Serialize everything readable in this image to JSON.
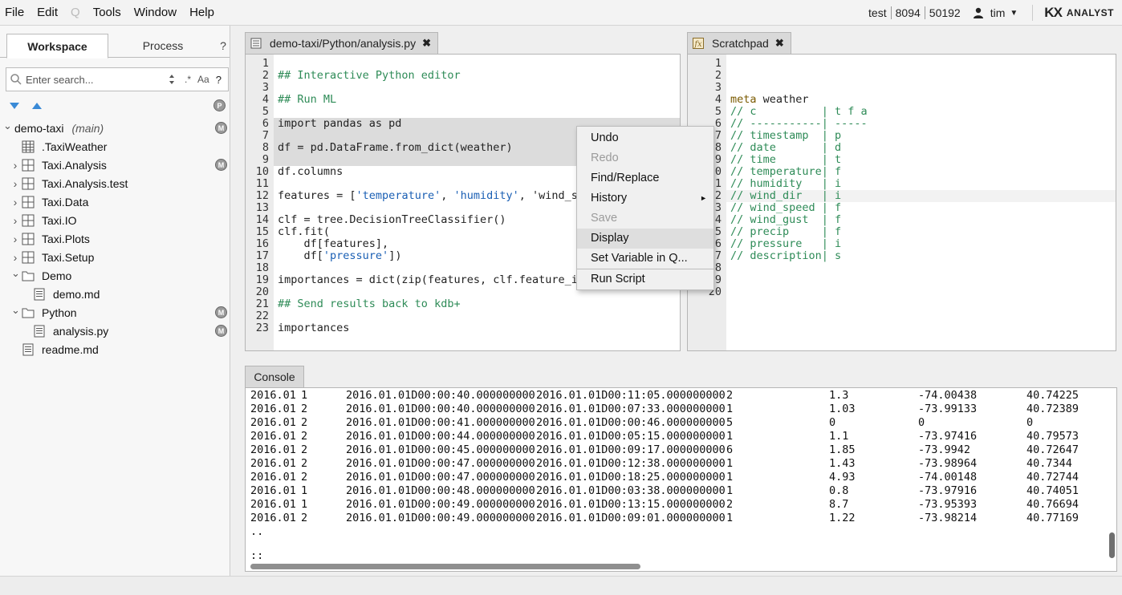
{
  "menu": {
    "items": [
      "File",
      "Edit",
      "Q",
      "Tools",
      "Window",
      "Help"
    ],
    "disabled_index": 2
  },
  "status": {
    "user_field": "test",
    "port": "8094",
    "pid": "50192",
    "username": "tim",
    "brand_kx": "KX",
    "brand_name": "ANALYST"
  },
  "sidebar": {
    "tabs": {
      "workspace": "Workspace",
      "process": "Process",
      "help": "?"
    },
    "search_placeholder": "Enter search...",
    "search_regex": ".*",
    "search_case": "Aa",
    "search_help": "?",
    "header_badge": "P",
    "tree": [
      {
        "label": "demo-taxi",
        "branch": "(main)",
        "indent": 0,
        "chevron": "down",
        "icon": "none",
        "badge": "M"
      },
      {
        "label": ".TaxiWeather",
        "indent": 1,
        "chevron": "",
        "icon": "table",
        "badge": ""
      },
      {
        "label": "Taxi.Analysis",
        "indent": 1,
        "chevron": "right",
        "icon": "grid",
        "badge": "M"
      },
      {
        "label": "Taxi.Analysis.test",
        "indent": 1,
        "chevron": "right",
        "icon": "grid",
        "badge": ""
      },
      {
        "label": "Taxi.Data",
        "indent": 1,
        "chevron": "right",
        "icon": "grid",
        "badge": ""
      },
      {
        "label": "Taxi.IO",
        "indent": 1,
        "chevron": "right",
        "icon": "grid",
        "badge": ""
      },
      {
        "label": "Taxi.Plots",
        "indent": 1,
        "chevron": "right",
        "icon": "grid",
        "badge": ""
      },
      {
        "label": "Taxi.Setup",
        "indent": 1,
        "chevron": "right",
        "icon": "grid",
        "badge": ""
      },
      {
        "label": "Demo",
        "indent": 1,
        "chevron": "down",
        "icon": "folder",
        "badge": ""
      },
      {
        "label": "demo.md",
        "indent": 2,
        "chevron": "",
        "icon": "doc",
        "badge": ""
      },
      {
        "label": "Python",
        "indent": 1,
        "chevron": "down",
        "icon": "folder",
        "badge": "M"
      },
      {
        "label": "analysis.py",
        "indent": 2,
        "chevron": "",
        "icon": "doc",
        "badge": "M"
      },
      {
        "label": "readme.md",
        "indent": 1,
        "chevron": "",
        "icon": "doc",
        "badge": ""
      }
    ]
  },
  "editor_left": {
    "tab_label": "demo-taxi/Python/analysis.py",
    "lines": [
      "",
      "## Interactive Python editor",
      "",
      "## Run ML",
      "",
      "import pandas as pd",
      "",
      "df = pd.DataFrame.from_dict(weather)",
      "",
      "df.columns",
      "",
      "features = ['temperature', 'humidity', 'wind_sp",
      "",
      "clf = tree.DecisionTreeClassifier()",
      "clf.fit(",
      "    df[features],",
      "    df['pressure'])",
      "",
      "importances = dict(zip(features, clf.feature_im",
      "",
      "## Send results back to kdb+",
      "",
      "importances"
    ]
  },
  "editor_right": {
    "tab_label": "Scratchpad",
    "gutter": [
      "1",
      "2",
      "3",
      "4",
      "5",
      "6",
      "7",
      "8",
      "9",
      "0",
      "1",
      "2",
      "3",
      "4",
      "5",
      "6",
      "7",
      "8",
      "9",
      "20"
    ],
    "lines": [
      "",
      "",
      "",
      "meta weather",
      "// c          | t f a",
      "// -----------| -----",
      "// timestamp  | p",
      "// date       | d",
      "// time       | t",
      "// temperature| f",
      "// humidity   | i",
      "// wind_dir   | i",
      "// wind_speed | f",
      "// wind_gust  | f",
      "// precip     | f",
      "// pressure   | i",
      "// description| s",
      "",
      "",
      ""
    ]
  },
  "context_menu": {
    "items": [
      {
        "label": "Undo",
        "state": "normal"
      },
      {
        "label": "Redo",
        "state": "disabled"
      },
      {
        "label": "Find/Replace",
        "state": "normal"
      },
      {
        "label": "History",
        "state": "normal",
        "submenu": "►"
      },
      {
        "label": "Save",
        "state": "disabled"
      },
      {
        "label": "Display",
        "state": "active"
      },
      {
        "label": "Set Variable in Q...",
        "state": "normal"
      },
      {
        "label": "Run Script",
        "state": "normal",
        "separator_before": true
      }
    ]
  },
  "console": {
    "tab_label": "Console",
    "rows": [
      [
        "2016.01",
        "1",
        "2016.01.01D00:00:40.000000000",
        "2016.01.01D00:11:05.000000000",
        "2",
        "1.3",
        "-74.00438",
        "40.74225"
      ],
      [
        "2016.01",
        "2",
        "2016.01.01D00:00:40.000000000",
        "2016.01.01D00:07:33.000000000",
        "1",
        "1.03",
        "-73.99133",
        "40.72389"
      ],
      [
        "2016.01",
        "2",
        "2016.01.01D00:00:41.000000000",
        "2016.01.01D00:00:46.000000000",
        "5",
        "0",
        "0",
        "0"
      ],
      [
        "2016.01",
        "2",
        "2016.01.01D00:00:44.000000000",
        "2016.01.01D00:05:15.000000000",
        "1",
        "1.1",
        "-73.97416",
        "40.79573"
      ],
      [
        "2016.01",
        "2",
        "2016.01.01D00:00:45.000000000",
        "2016.01.01D00:09:17.000000000",
        "6",
        "1.85",
        "-73.9942",
        "40.72647"
      ],
      [
        "2016.01",
        "2",
        "2016.01.01D00:00:47.000000000",
        "2016.01.01D00:12:38.000000000",
        "1",
        "1.43",
        "-73.98964",
        "40.7344"
      ],
      [
        "2016.01",
        "2",
        "2016.01.01D00:00:47.000000000",
        "2016.01.01D00:18:25.000000000",
        "1",
        "4.93",
        "-74.00148",
        "40.72744"
      ],
      [
        "2016.01",
        "1",
        "2016.01.01D00:00:48.000000000",
        "2016.01.01D00:03:38.000000000",
        "1",
        "0.8",
        "-73.97916",
        "40.74051"
      ],
      [
        "2016.01",
        "1",
        "2016.01.01D00:00:49.000000000",
        "2016.01.01D00:13:15.000000000",
        "2",
        "8.7",
        "-73.95393",
        "40.76694"
      ],
      [
        "2016.01",
        "2",
        "2016.01.01D00:00:49.000000000",
        "2016.01.01D00:09:01.000000000",
        "1",
        "1.22",
        "-73.98214",
        "40.77169"
      ]
    ],
    "trailer_1": "..",
    "trailer_2": "::"
  }
}
